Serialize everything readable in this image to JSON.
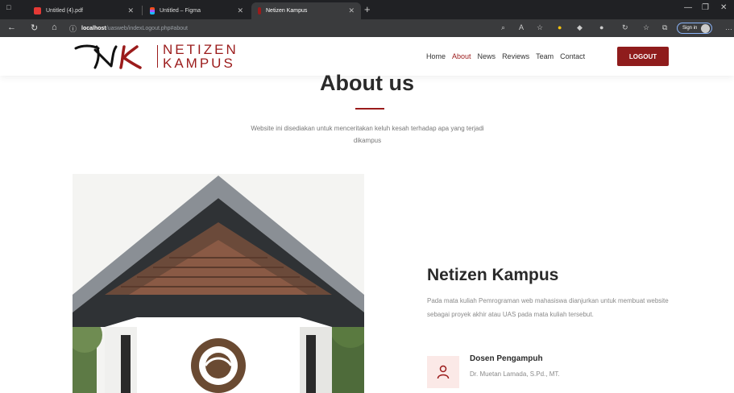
{
  "browser": {
    "tabs": [
      {
        "title": "Untitled (4).pdf",
        "icon": "pdf-icon"
      },
      {
        "title": "Untitled – Figma",
        "icon": "figma-icon"
      },
      {
        "title": "Netizen Kampus",
        "icon": "site-icon"
      }
    ],
    "url_host": "localhost",
    "url_path": "/uasweb/indexLogout.php#about",
    "signin_label": "Sign in"
  },
  "site": {
    "logo_monogram": "NK",
    "logo_line1": "NETIZEN",
    "logo_line2": "KAMPUS",
    "nav": [
      "Home",
      "About",
      "News",
      "Reviews",
      "Team",
      "Contact"
    ],
    "active_nav": "About",
    "logout_label": "LOGOUT"
  },
  "about": {
    "title": "About us",
    "description": "Website ini disediakan untuk menceritakan keluh kesah terhadap apa yang terjadi dikampus"
  },
  "info": {
    "title": "Netizen Kampus",
    "description": "Pada mata kuliah Pemrograman web mahasiswa dianjurkan untuk membuat website sebagai proyek akhir atau UAS pada mata kuliah tersebut.",
    "dosen_title": "Dosen Pengampuh",
    "dosen_name": "Dr. Muetan Lamada, S.Pd., MT."
  },
  "colors": {
    "brand": "#9b1b1b",
    "logout_bg": "#8f1c1c",
    "icon_bg": "#fbe9e7"
  }
}
